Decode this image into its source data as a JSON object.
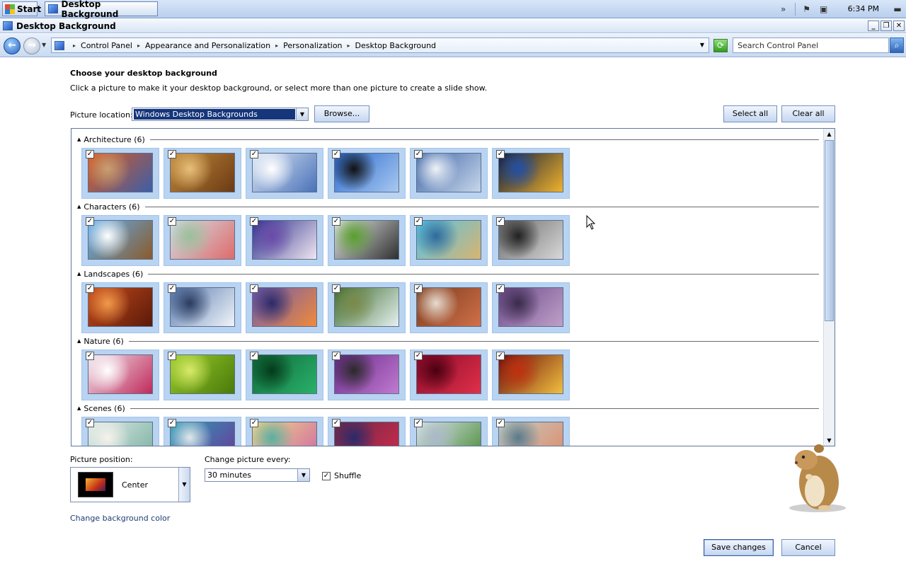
{
  "taskbar": {
    "start_label": "Start",
    "task_label": "Desktop Background",
    "clock": "6:34 PM"
  },
  "window": {
    "title": "Desktop Background"
  },
  "address": {
    "breadcrumb": [
      "Control Panel",
      "Appearance and Personalization",
      "Personalization",
      "Desktop Background"
    ],
    "search_placeholder": "Search Control Panel"
  },
  "main": {
    "heading": "Choose your desktop background",
    "subtext": "Click a picture to make it your desktop background, or select more than one picture to create a slide show.",
    "location_label": "Picture location:",
    "location_value": "Windows Desktop Backgrounds",
    "browse_label": "Browse...",
    "select_all_label": "Select all",
    "clear_all_label": "Clear all"
  },
  "gallery": {
    "categories": [
      {
        "label": "Architecture (6)",
        "tiles": [
          {
            "checked": true,
            "colors": [
              "#e05a1c",
              "#3b5ea8",
              "#c8a070"
            ]
          },
          {
            "checked": true,
            "colors": [
              "#c28a3a",
              "#6b3a14",
              "#e8c07a"
            ]
          },
          {
            "checked": true,
            "colors": [
              "#dbe6f5",
              "#4a72b8",
              "#ffffff"
            ]
          },
          {
            "checked": true,
            "colors": [
              "#2a6ad0",
              "#a8c8f0",
              "#111111"
            ]
          },
          {
            "checked": true,
            "colors": [
              "#3f66a8",
              "#c7d6ea",
              "#eef2f7"
            ]
          },
          {
            "checked": true,
            "colors": [
              "#0c1a3c",
              "#f0b22c",
              "#2250a8"
            ]
          }
        ]
      },
      {
        "label": "Characters (6)",
        "tiles": [
          {
            "checked": true,
            "colors": [
              "#5fb0f2",
              "#8a5a2a",
              "#ffffff"
            ]
          },
          {
            "checked": true,
            "colors": [
              "#cfe2ea",
              "#e06a6a",
              "#9ac09a"
            ]
          },
          {
            "checked": true,
            "colors": [
              "#2b2f8c",
              "#f0e6f0",
              "#6a4aa8"
            ]
          },
          {
            "checked": true,
            "colors": [
              "#e4e8e6",
              "#2f2f2f",
              "#58a02c"
            ]
          },
          {
            "checked": true,
            "colors": [
              "#52c4e8",
              "#d8b470",
              "#2e6a9c"
            ]
          },
          {
            "checked": true,
            "colors": [
              "#6a6a6a",
              "#d8d8d8",
              "#202020"
            ]
          }
        ]
      },
      {
        "label": "Landscapes (6)",
        "tiles": [
          {
            "checked": true,
            "colors": [
              "#c74a1a",
              "#5a1a0a",
              "#f29a4a"
            ]
          },
          {
            "checked": true,
            "colors": [
              "#5a7cb0",
              "#f0f4f8",
              "#2a3a60"
            ]
          },
          {
            "checked": true,
            "colors": [
              "#6c5ab0",
              "#f08a3a",
              "#2a2a6a"
            ]
          },
          {
            "checked": true,
            "colors": [
              "#3a6a2a",
              "#e6f0f0",
              "#7a8a4a"
            ]
          },
          {
            "checked": true,
            "colors": [
              "#7a3a1a",
              "#d0704a",
              "#e8dcd0"
            ]
          },
          {
            "checked": true,
            "colors": [
              "#6a4a8a",
              "#c0a0c8",
              "#3a2a4a"
            ]
          }
        ]
      },
      {
        "label": "Nature (6)",
        "tiles": [
          {
            "checked": true,
            "colors": [
              "#f0e6ee",
              "#c02a5a",
              "#ffffff"
            ]
          },
          {
            "checked": true,
            "colors": [
              "#9acc2a",
              "#4a7a0a",
              "#d8ea6a"
            ]
          },
          {
            "checked": true,
            "colors": [
              "#0e6a3a",
              "#2ab06a",
              "#053a1a"
            ]
          },
          {
            "checked": true,
            "colors": [
              "#6a2a8a",
              "#c07ad0",
              "#2a2a2a"
            ]
          },
          {
            "checked": true,
            "colors": [
              "#8a0a2a",
              "#e0304a",
              "#4a0010"
            ]
          },
          {
            "checked": true,
            "colors": [
              "#6a0a0a",
              "#f0c040",
              "#c03010"
            ]
          }
        ]
      },
      {
        "label": "Scenes (6)",
        "tiles": [
          {
            "checked": true,
            "colors": [
              "#e0ecea",
              "#7ab0a0",
              "#f6f2ea"
            ]
          },
          {
            "checked": true,
            "colors": [
              "#2aa0b8",
              "#6a3a9a",
              "#e0e8ea"
            ]
          },
          {
            "checked": true,
            "colors": [
              "#f0d88a",
              "#d06aa0",
              "#5ab0a0"
            ]
          },
          {
            "checked": true,
            "colors": [
              "#6a2a4a",
              "#d02a4a",
              "#2a2a6a"
            ]
          },
          {
            "checked": true,
            "colors": [
              "#dce6ea",
              "#4a8a3a",
              "#aab8c8"
            ]
          },
          {
            "checked": true,
            "colors": [
              "#c0d0c8",
              "#e08a6a",
              "#5a7a8a"
            ]
          }
        ]
      }
    ]
  },
  "options": {
    "position_label": "Picture position:",
    "position_value": "Center",
    "change_label": "Change picture every:",
    "change_value": "30 minutes",
    "shuffle_label": "Shuffle",
    "shuffle_checked": true,
    "bg_color_link": "Change background color"
  },
  "footer": {
    "save_label": "Save changes",
    "cancel_label": "Cancel"
  }
}
